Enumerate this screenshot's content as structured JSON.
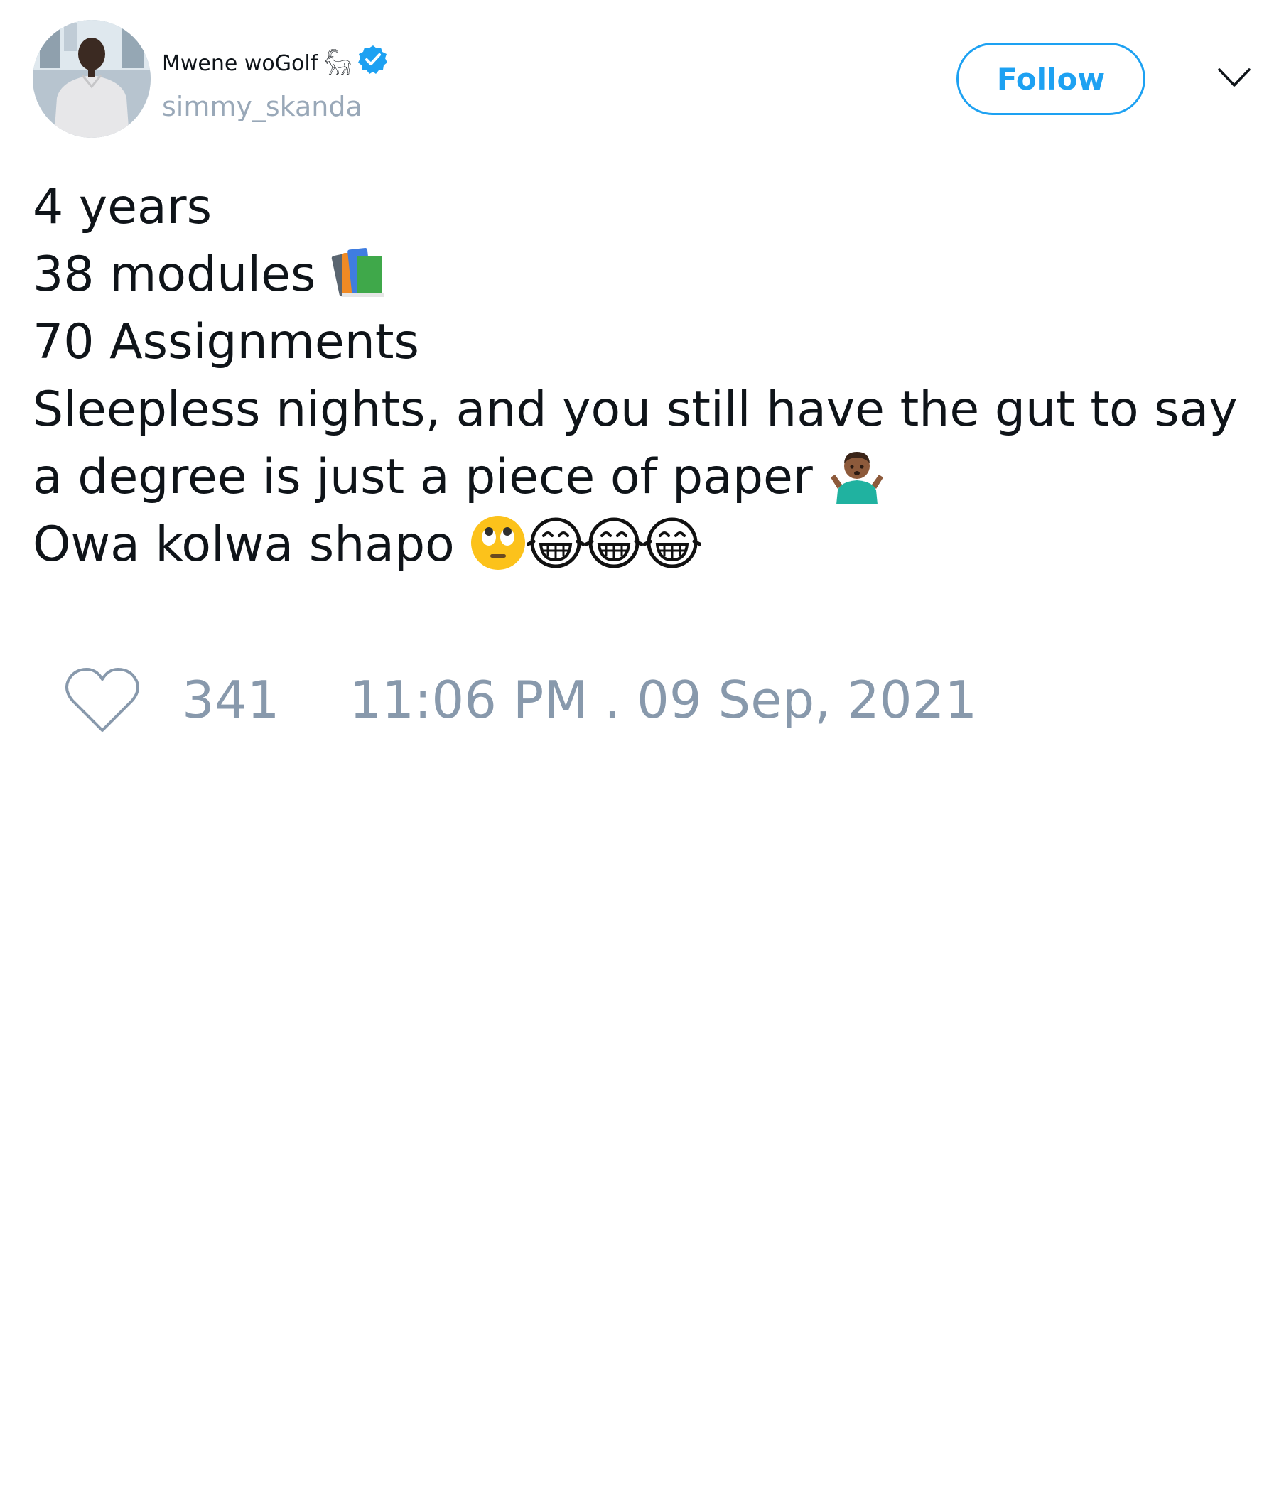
{
  "user": {
    "display_name": "Mwene woGolf 𓃵",
    "handle": "simmy_skanda",
    "verified_icon": "verified-badge-icon",
    "verified_color": "#1da1f2"
  },
  "actions": {
    "follow_label": "Follow",
    "menu_icon": "chevron-down-icon"
  },
  "tweet": {
    "line_1": "4 years",
    "line_2": "38 modules",
    "line_2_emoji": "books-emoji",
    "line_3": "70 Assignments",
    "line_4": "Sleepless nights, and you still have the gut to say",
    "line_5": "a degree is just a piece of paper",
    "line_5_emoji": "man-shrugging-emoji",
    "line_6": "Owa kolwa shapo",
    "line_6_emojis": [
      "face-with-rolling-eyes-emoji",
      "laughing-tears-emoji",
      "laughing-tears-emoji",
      "laughing-tears-emoji"
    ]
  },
  "footer": {
    "like_icon": "heart-icon",
    "like_count": "341",
    "timestamp": "11:06 PM . 09 Sep, 2021"
  },
  "colors": {
    "accent": "#1da1f2",
    "muted": "#8899ac",
    "text": "#0f1419"
  }
}
